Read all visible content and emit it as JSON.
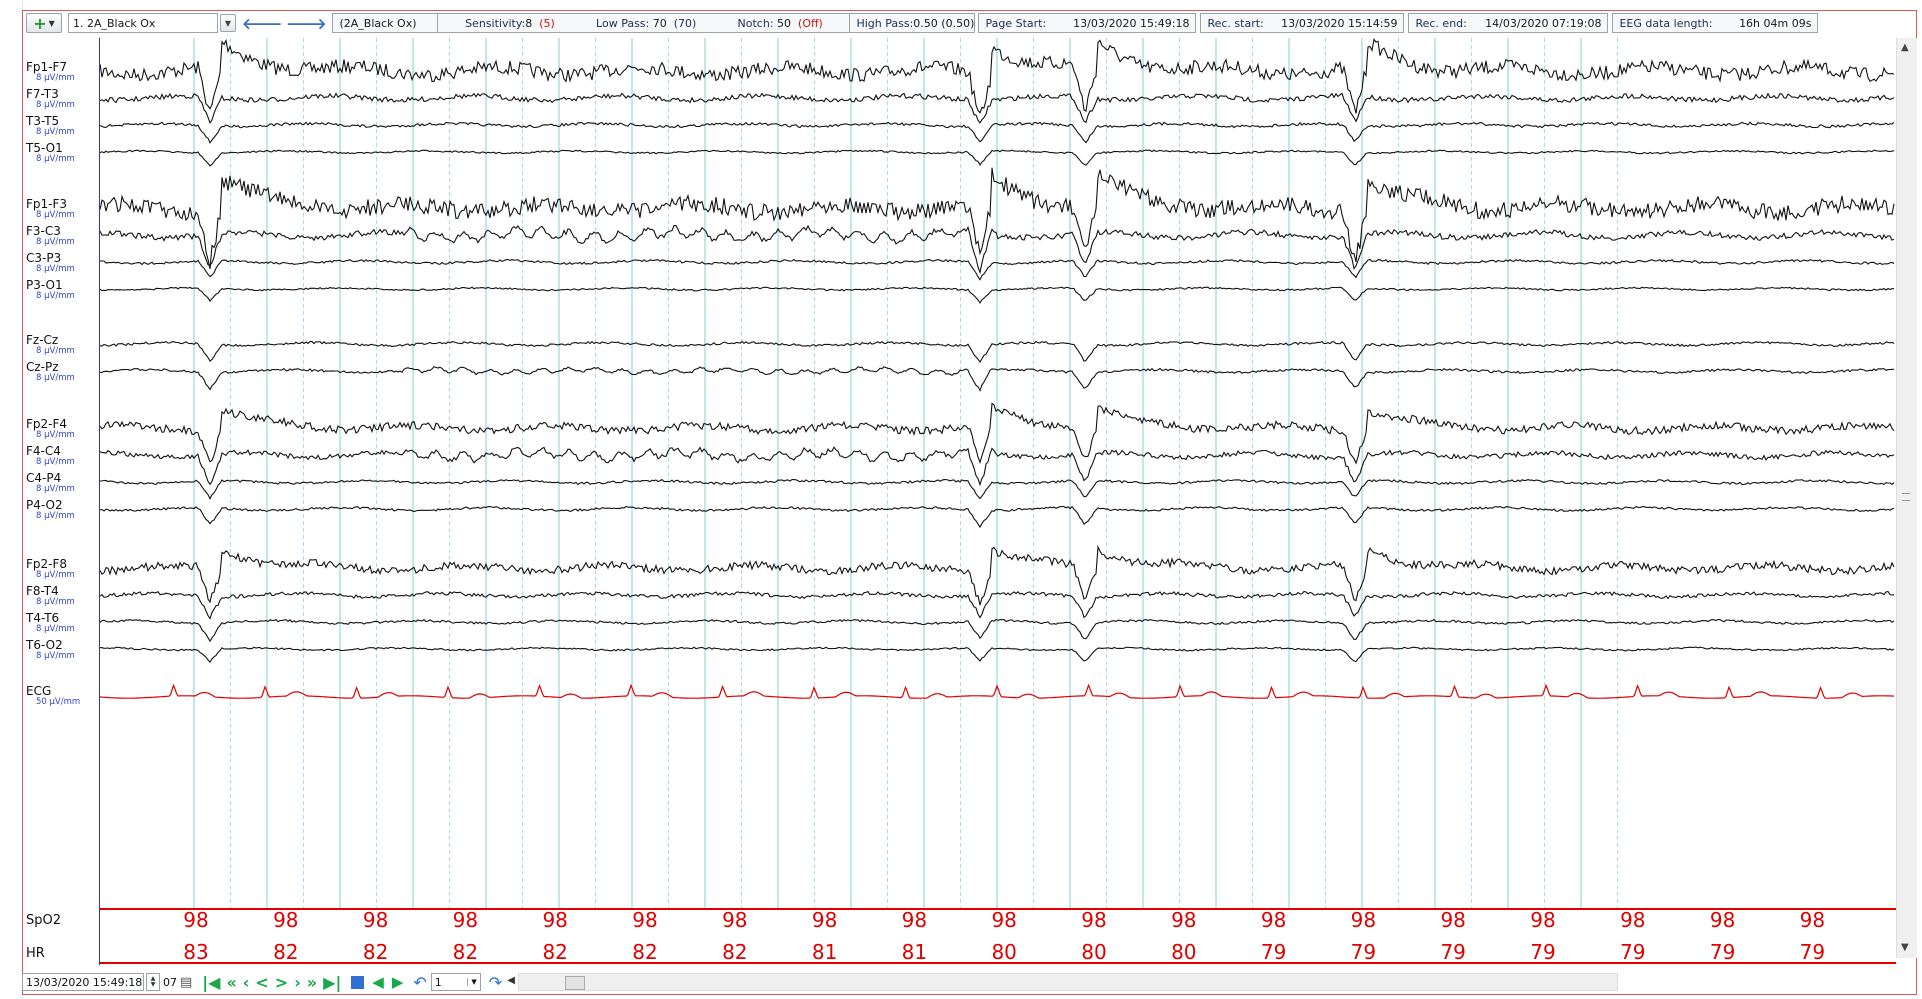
{
  "toolbar": {
    "add_label": "+",
    "patient": "1. 2A_Black Ox",
    "montage": "(2A_Black Ox)",
    "sensitivity_label": "Sensitivity:",
    "sensitivity_value": "8",
    "sensitivity_alt": "(5)",
    "lowpass_label": "Low Pass:",
    "lowpass_value": "70",
    "lowpass_alt": "(70)",
    "notch_label": "Notch:",
    "notch_value": "50",
    "notch_alt": "(Off)",
    "highpass_label": "High Pass:",
    "highpass_value": "0.50 (0.50)",
    "page_start_label": "Page Start:",
    "page_start_value": "13/03/2020 15:49:18",
    "rec_start_label": "Rec. start:",
    "rec_start_value": "13/03/2020 15:14:59",
    "rec_end_label": "Rec. end:",
    "rec_end_value": "14/03/2020 07:19:08",
    "eeg_length_label": "EEG data length:",
    "eeg_length_value": "16h 04m 09s"
  },
  "channels": [
    {
      "name": "Fp1-F7",
      "unit": "8 µV/mm",
      "amp": 11,
      "noise": 0.9
    },
    {
      "name": "F7-T3",
      "unit": "8 µV/mm",
      "amp": 6,
      "noise": 0.6
    },
    {
      "name": "T3-T5",
      "unit": "8 µV/mm",
      "amp": 4,
      "noise": 0.5
    },
    {
      "name": "T5-O1",
      "unit": "8 µV/mm",
      "amp": 3,
      "noise": 0.4
    },
    {
      "name": "Fp1-F3",
      "unit": "8 µV/mm",
      "amp": 12,
      "noise": 1.0
    },
    {
      "name": "F3-C3",
      "unit": "8 µV/mm",
      "amp": 8,
      "noise": 0.5
    },
    {
      "name": "C3-P3",
      "unit": "8 µV/mm",
      "amp": 4,
      "noise": 0.4
    },
    {
      "name": "P3-O1",
      "unit": "8 µV/mm",
      "amp": 3,
      "noise": 0.4
    },
    {
      "name": "Fz-Cz",
      "unit": "8 µV/mm",
      "amp": 4,
      "noise": 0.4
    },
    {
      "name": "Cz-Pz",
      "unit": "8 µV/mm",
      "amp": 4,
      "noise": 0.4
    },
    {
      "name": "Fp2-F4",
      "unit": "8 µV/mm",
      "amp": 8,
      "noise": 0.7
    },
    {
      "name": "F4-C4",
      "unit": "8 µV/mm",
      "amp": 7,
      "noise": 0.5
    },
    {
      "name": "C4-P4",
      "unit": "8 µV/mm",
      "amp": 4,
      "noise": 0.4
    },
    {
      "name": "P4-O2",
      "unit": "8 µV/mm",
      "amp": 4,
      "noise": 0.4
    },
    {
      "name": "Fp2-F8",
      "unit": "8 µV/mm",
      "amp": 8,
      "noise": 0.7
    },
    {
      "name": "F8-T4",
      "unit": "8 µV/mm",
      "amp": 5,
      "noise": 0.5
    },
    {
      "name": "T4-T6",
      "unit": "8 µV/mm",
      "amp": 4,
      "noise": 0.4
    },
    {
      "name": "T6-O2",
      "unit": "8 µV/mm",
      "amp": 3,
      "noise": 0.4
    }
  ],
  "ecg": {
    "name": "ECG",
    "unit": "50 µV/mm",
    "color": "#e00000"
  },
  "spo2": {
    "label": "SpO2",
    "values": [
      "98",
      "98",
      "98",
      "98",
      "98",
      "98",
      "98",
      "98",
      "98",
      "98",
      "98",
      "98",
      "98",
      "98",
      "98",
      "98",
      "98",
      "98",
      "98"
    ]
  },
  "hr": {
    "label": "HR",
    "values": [
      "83",
      "82",
      "82",
      "82",
      "82",
      "82",
      "82",
      "81",
      "81",
      "80",
      "80",
      "80",
      "79",
      "79",
      "79",
      "79",
      "79",
      "79",
      "79"
    ]
  },
  "bottom": {
    "datetime": "13/03/2020 15:49:18",
    "page": "07",
    "speed": "1"
  },
  "colors": {
    "trace": "#111111",
    "ecg": "#e00000",
    "grid": "#7fd3d3",
    "accent": "#3333cc"
  }
}
